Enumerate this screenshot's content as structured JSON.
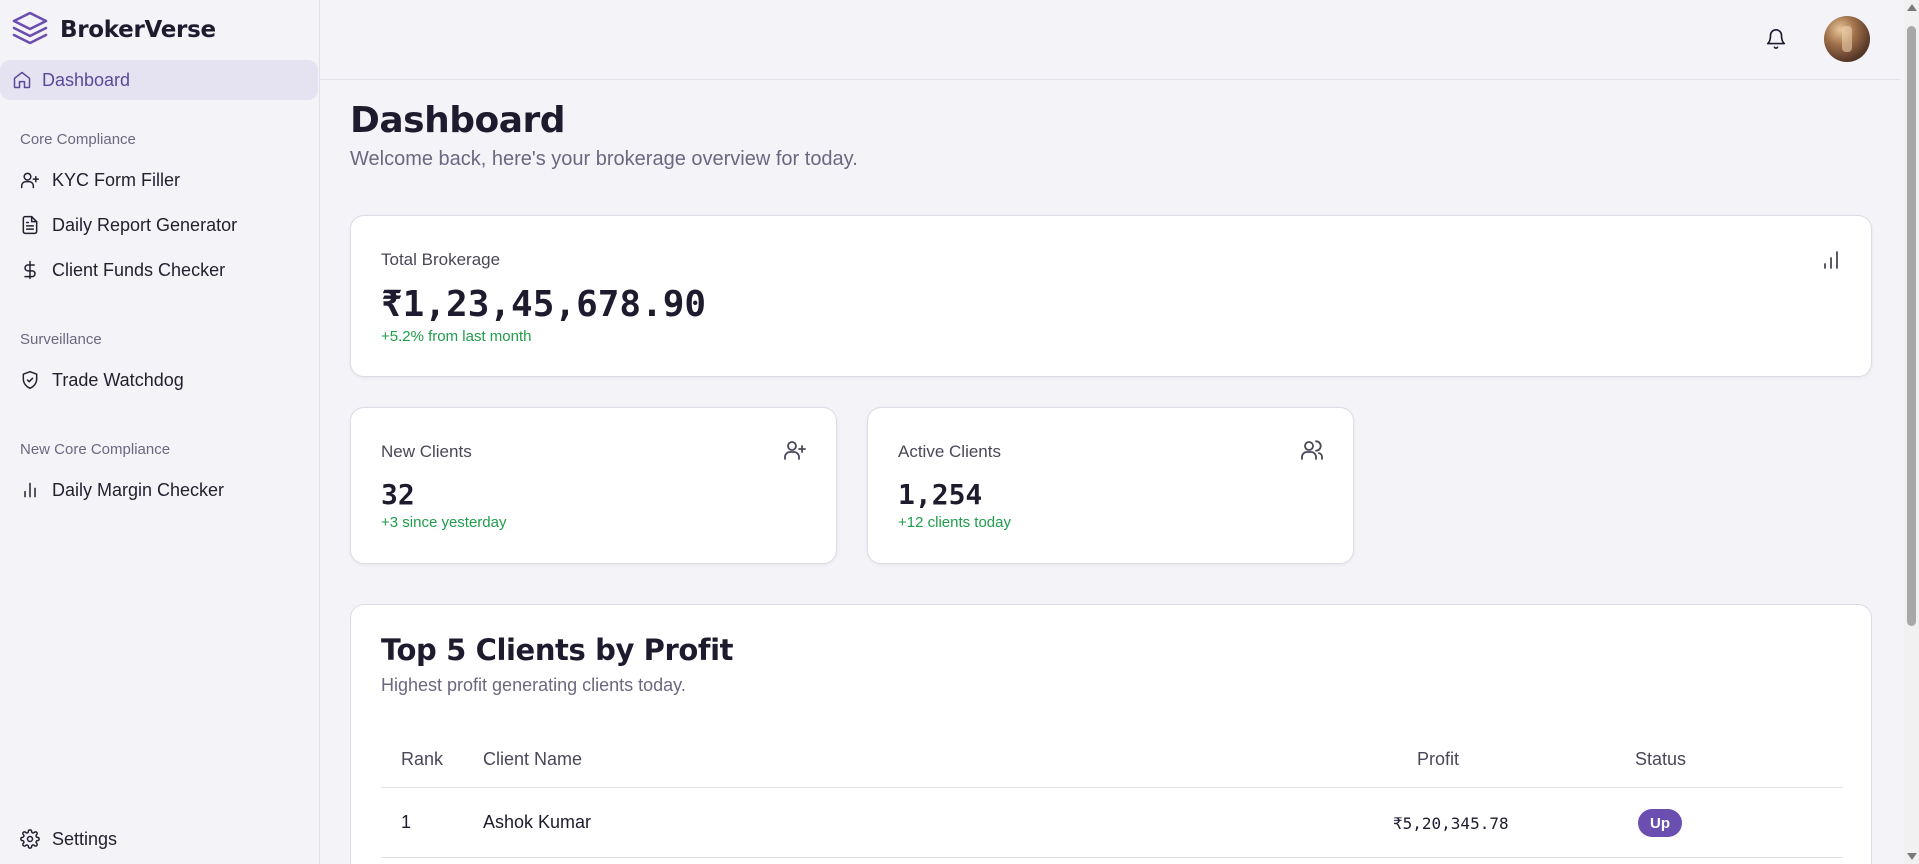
{
  "app": {
    "name": "BrokerVerse"
  },
  "sidebar": {
    "active": {
      "label": "Dashboard",
      "icon": "home-icon"
    },
    "sections": [
      {
        "label": "Core Compliance",
        "items": [
          {
            "label": "KYC Form Filler",
            "icon": "user-plus-icon"
          },
          {
            "label": "Daily Report Generator",
            "icon": "file-text-icon"
          },
          {
            "label": "Client Funds Checker",
            "icon": "dollar-sign-icon"
          }
        ]
      },
      {
        "label": "Surveillance",
        "items": [
          {
            "label": "Trade Watchdog",
            "icon": "shield-check-icon"
          }
        ]
      },
      {
        "label": "New Core Compliance",
        "items": [
          {
            "label": "Daily Margin Checker",
            "icon": "bar-chart-icon"
          }
        ]
      }
    ],
    "settings": {
      "label": "Settings",
      "icon": "gear-icon"
    }
  },
  "header": {
    "notification_icon": "bell-icon",
    "avatar": "user-avatar"
  },
  "page": {
    "title": "Dashboard",
    "subtitle": "Welcome back, here's your brokerage overview for today."
  },
  "stats": {
    "total_brokerage": {
      "title": "Total Brokerage",
      "value": "₹1,23,45,678.90",
      "delta": "+5.2% from last month",
      "icon": "bar-chart-icon"
    },
    "new_clients": {
      "title": "New Clients",
      "value": "32",
      "delta": "+3 since yesterday",
      "icon": "user-plus-icon"
    },
    "active_clients": {
      "title": "Active Clients",
      "value": "1,254",
      "delta": "+12 clients today",
      "icon": "users-icon"
    }
  },
  "top_clients": {
    "title": "Top 5 Clients by Profit",
    "subtitle": "Highest profit generating clients today.",
    "columns": [
      "Rank",
      "Client Name",
      "Profit",
      "Status"
    ],
    "rows": [
      {
        "rank": "1",
        "name": "Ashok Kumar",
        "profit": "₹5,20,345.78",
        "status": "Up"
      }
    ]
  },
  "colors": {
    "accent": "#6a4fb0",
    "positive": "#1f9d4a",
    "active_nav_bg": "#e5e2f1"
  }
}
